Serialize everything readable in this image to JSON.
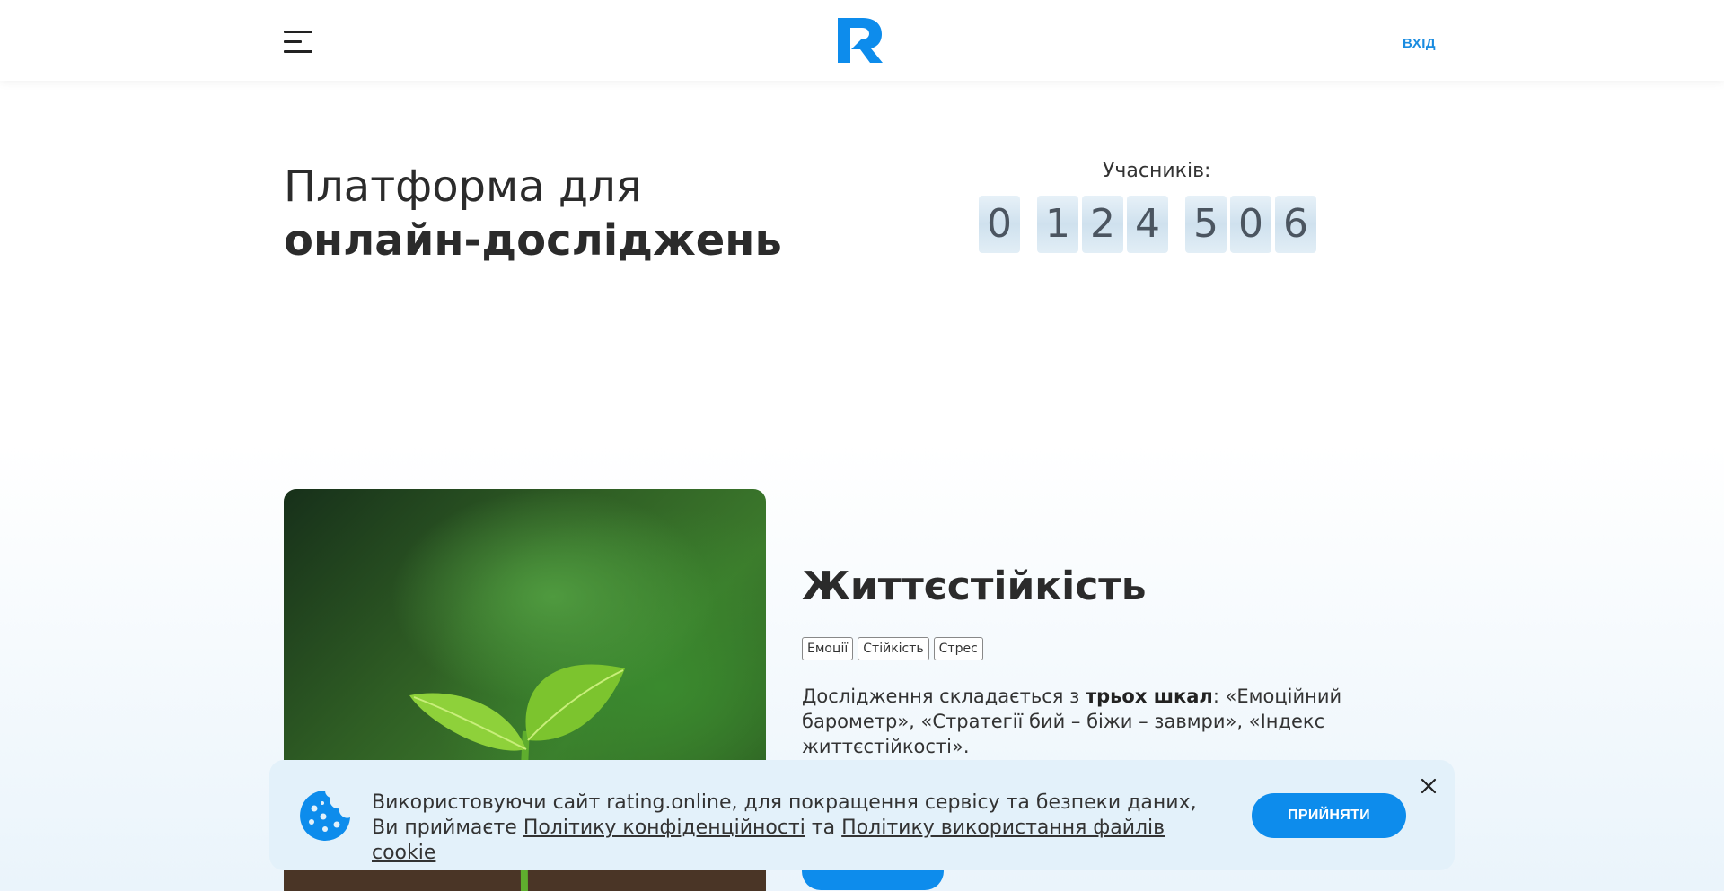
{
  "header": {
    "menu_icon": "hamburger-menu-icon",
    "logo_icon": "r-logo",
    "brand_color": "#0d8cec",
    "login_label": "ВХІД"
  },
  "hero": {
    "title_light": "Платформа для",
    "title_bold": "онлайн-досліджень",
    "participants_label": "Учасників:",
    "counter_digits": [
      "0",
      "1",
      "2",
      "4",
      "5",
      "0",
      "6"
    ]
  },
  "study": {
    "title": "Життєстійкість",
    "tags": [
      "Емоції",
      "Стійкість",
      "Стрес"
    ],
    "desc_before": "Дослідження складається з ",
    "desc_bold": "трьох шкал",
    "desc_after": ": «Емоційний барометр», «Стратегії бий – біжи – завмри», «Індекс життєстійкості»."
  },
  "cookie": {
    "icon": "cookie-icon",
    "text_1": "Використовуючи сайт rating.online, для покращення сервісу та безпеки даних, Ви приймаєте ",
    "privacy_link": "Політику конфіденційності",
    "text_2": " та ",
    "cookie_link": "Політику використання файлів cookie",
    "accept_label": "ПРИЙНЯТИ",
    "close_icon": "close-icon"
  }
}
